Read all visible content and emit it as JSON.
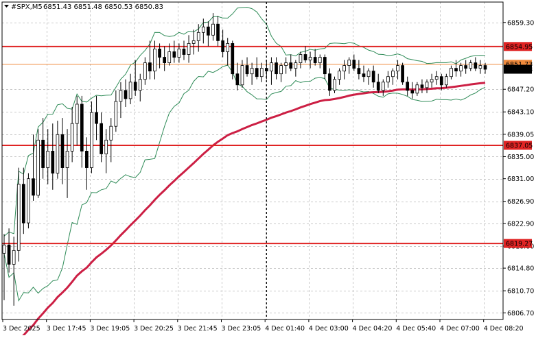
{
  "chart_data": {
    "type": "candlestick",
    "title": {
      "symbol": "#SPX,M5",
      "ohlc": "6851.43 6851.48 6850.53 6850.83"
    },
    "ylim": [
      6805.5,
      6863.0
    ],
    "y_ticks": [
      6859.3,
      6847.2,
      6843.1,
      6839.05,
      6835.0,
      6831.0,
      6826.9,
      6822.9,
      6818.8,
      6814.8,
      6810.7,
      6806.7
    ],
    "y_tick_labels": [
      "6859.30",
      "6847.20",
      "6843.10",
      "6839.05",
      "6835.00",
      "6831.00",
      "6826.90",
      "6822.90",
      "6818.80",
      "6814.80",
      "6810.70",
      "6806.70"
    ],
    "x_tick_labels": [
      "3 Dec 2025",
      "3 Dec 17:45",
      "3 Dec 19:05",
      "3 Dec 20:25",
      "3 Dec 21:45",
      "3 Dec 23:05",
      "4 Dec 01:40",
      "4 Dec 03:00",
      "4 Dec 04:20",
      "4 Dec 05:40",
      "4 Dec 07:00",
      "4 Dec 08:20"
    ],
    "horizontal_levels": [
      {
        "label": "6854.95",
        "value": 6854.95,
        "color": "#e02424",
        "style": "solid"
      },
      {
        "label": "6851.73",
        "value": 6851.73,
        "color": "#f08a3c",
        "style": "solid"
      },
      {
        "label": "6837.05",
        "value": 6837.05,
        "color": "#e02424",
        "style": "solid"
      },
      {
        "label": "6819.27",
        "value": 6819.27,
        "color": "#e02424",
        "style": "solid"
      }
    ],
    "current_price": {
      "label": "6850.83",
      "value": 6850.83
    },
    "vertical_marker_index": 54,
    "grid": true,
    "colors": {
      "candle": "#000000",
      "bands": "#2e8b57",
      "moving_average": "#cc1f44",
      "level": "#e02424",
      "level_secondary": "#f08a3c",
      "grid": "#c8c8c8"
    },
    "candles": [
      {
        "o": 6817.5,
        "h": 6821.0,
        "l": 6809.0,
        "c": 6819.0
      },
      {
        "o": 6819.0,
        "h": 6822.0,
        "l": 6814.0,
        "c": 6815.5
      },
      {
        "o": 6815.5,
        "h": 6820.5,
        "l": 6808.0,
        "c": 6818.0
      },
      {
        "o": 6818.0,
        "h": 6833.0,
        "l": 6816.0,
        "c": 6830.0
      },
      {
        "o": 6830.0,
        "h": 6833.0,
        "l": 6821.0,
        "c": 6823.0
      },
      {
        "o": 6823.0,
        "h": 6832.0,
        "l": 6822.0,
        "c": 6831.0
      },
      {
        "o": 6831.0,
        "h": 6839.0,
        "l": 6827.0,
        "c": 6828.0
      },
      {
        "o": 6828.0,
        "h": 6840.0,
        "l": 6827.5,
        "c": 6838.0
      },
      {
        "o": 6838.0,
        "h": 6842.0,
        "l": 6831.0,
        "c": 6833.0
      },
      {
        "o": 6833.0,
        "h": 6840.0,
        "l": 6830.0,
        "c": 6836.0
      },
      {
        "o": 6836.0,
        "h": 6841.0,
        "l": 6829.0,
        "c": 6832.0
      },
      {
        "o": 6832.0,
        "h": 6841.5,
        "l": 6831.0,
        "c": 6839.0
      },
      {
        "o": 6839.0,
        "h": 6842.0,
        "l": 6830.0,
        "c": 6833.0
      },
      {
        "o": 6833.0,
        "h": 6840.0,
        "l": 6827.5,
        "c": 6836.0
      },
      {
        "o": 6836.0,
        "h": 6844.0,
        "l": 6834.0,
        "c": 6841.0
      },
      {
        "o": 6841.0,
        "h": 6846.0,
        "l": 6837.0,
        "c": 6844.5
      },
      {
        "o": 6844.5,
        "h": 6846.0,
        "l": 6833.0,
        "c": 6836.0
      },
      {
        "o": 6836.0,
        "h": 6838.5,
        "l": 6829.0,
        "c": 6833.0
      },
      {
        "o": 6833.0,
        "h": 6845.0,
        "l": 6832.0,
        "c": 6843.0
      },
      {
        "o": 6843.0,
        "h": 6846.0,
        "l": 6838.0,
        "c": 6841.0
      },
      {
        "o": 6841.0,
        "h": 6843.0,
        "l": 6834.0,
        "c": 6835.5
      },
      {
        "o": 6835.5,
        "h": 6840.0,
        "l": 6832.0,
        "c": 6838.0
      },
      {
        "o": 6838.0,
        "h": 6842.0,
        "l": 6834.0,
        "c": 6840.5
      },
      {
        "o": 6840.5,
        "h": 6847.0,
        "l": 6839.5,
        "c": 6845.0
      },
      {
        "o": 6845.0,
        "h": 6848.5,
        "l": 6842.0,
        "c": 6847.0
      },
      {
        "o": 6847.0,
        "h": 6849.0,
        "l": 6844.0,
        "c": 6845.5
      },
      {
        "o": 6845.5,
        "h": 6850.0,
        "l": 6844.5,
        "c": 6848.5
      },
      {
        "o": 6848.5,
        "h": 6852.5,
        "l": 6846.0,
        "c": 6847.0
      },
      {
        "o": 6847.0,
        "h": 6850.0,
        "l": 6845.0,
        "c": 6849.0
      },
      {
        "o": 6849.0,
        "h": 6853.0,
        "l": 6848.0,
        "c": 6852.0
      },
      {
        "o": 6852.0,
        "h": 6856.0,
        "l": 6849.0,
        "c": 6850.5
      },
      {
        "o": 6850.5,
        "h": 6856.0,
        "l": 6849.0,
        "c": 6854.5
      },
      {
        "o": 6854.5,
        "h": 6855.5,
        "l": 6851.0,
        "c": 6853.0
      },
      {
        "o": 6853.0,
        "h": 6855.0,
        "l": 6850.5,
        "c": 6852.0
      },
      {
        "o": 6852.0,
        "h": 6855.5,
        "l": 6851.5,
        "c": 6854.0
      },
      {
        "o": 6854.0,
        "h": 6856.0,
        "l": 6852.0,
        "c": 6853.0
      },
      {
        "o": 6853.0,
        "h": 6855.5,
        "l": 6852.0,
        "c": 6854.5
      },
      {
        "o": 6854.5,
        "h": 6856.0,
        "l": 6852.5,
        "c": 6853.5
      },
      {
        "o": 6853.5,
        "h": 6857.0,
        "l": 6852.0,
        "c": 6855.5
      },
      {
        "o": 6855.5,
        "h": 6858.0,
        "l": 6853.5,
        "c": 6856.0
      },
      {
        "o": 6856.0,
        "h": 6859.0,
        "l": 6854.0,
        "c": 6857.5
      },
      {
        "o": 6857.5,
        "h": 6860.0,
        "l": 6855.5,
        "c": 6858.5
      },
      {
        "o": 6858.5,
        "h": 6859.5,
        "l": 6855.0,
        "c": 6857.0
      },
      {
        "o": 6857.0,
        "h": 6861.0,
        "l": 6856.0,
        "c": 6859.0
      },
      {
        "o": 6859.0,
        "h": 6860.5,
        "l": 6855.0,
        "c": 6856.0
      },
      {
        "o": 6856.0,
        "h": 6858.0,
        "l": 6853.0,
        "c": 6854.0
      },
      {
        "o": 6854.0,
        "h": 6856.5,
        "l": 6851.5,
        "c": 6855.5
      },
      {
        "o": 6855.5,
        "h": 6856.0,
        "l": 6849.0,
        "c": 6850.0
      },
      {
        "o": 6850.0,
        "h": 6852.0,
        "l": 6847.0,
        "c": 6848.0
      },
      {
        "o": 6848.0,
        "h": 6852.5,
        "l": 6847.5,
        "c": 6851.5
      },
      {
        "o": 6851.5,
        "h": 6853.0,
        "l": 6849.5,
        "c": 6850.0
      },
      {
        "o": 6850.0,
        "h": 6852.0,
        "l": 6848.0,
        "c": 6851.0
      },
      {
        "o": 6851.0,
        "h": 6853.0,
        "l": 6849.0,
        "c": 6849.5
      },
      {
        "o": 6849.5,
        "h": 6852.0,
        "l": 6848.5,
        "c": 6851.0
      },
      {
        "o": 6851.0,
        "h": 6852.5,
        "l": 6849.0,
        "c": 6850.5
      },
      {
        "o": 6850.5,
        "h": 6853.0,
        "l": 6848.0,
        "c": 6852.0
      },
      {
        "o": 6852.0,
        "h": 6853.0,
        "l": 6849.0,
        "c": 6850.0
      },
      {
        "o": 6850.0,
        "h": 6852.0,
        "l": 6848.5,
        "c": 6851.5
      },
      {
        "o": 6851.5,
        "h": 6853.0,
        "l": 6850.0,
        "c": 6852.0
      },
      {
        "o": 6852.0,
        "h": 6853.5,
        "l": 6850.5,
        "c": 6851.0
      },
      {
        "o": 6851.0,
        "h": 6852.5,
        "l": 6849.5,
        "c": 6852.0
      },
      {
        "o": 6852.0,
        "h": 6854.0,
        "l": 6851.0,
        "c": 6853.5
      },
      {
        "o": 6853.5,
        "h": 6855.0,
        "l": 6852.0,
        "c": 6852.5
      },
      {
        "o": 6852.5,
        "h": 6854.0,
        "l": 6851.0,
        "c": 6853.0
      },
      {
        "o": 6853.0,
        "h": 6854.5,
        "l": 6851.5,
        "c": 6852.0
      },
      {
        "o": 6852.0,
        "h": 6853.5,
        "l": 6851.0,
        "c": 6853.0
      },
      {
        "o": 6853.0,
        "h": 6853.5,
        "l": 6849.0,
        "c": 6850.0
      },
      {
        "o": 6850.0,
        "h": 6851.0,
        "l": 6846.0,
        "c": 6847.0
      },
      {
        "o": 6847.0,
        "h": 6849.5,
        "l": 6846.5,
        "c": 6849.0
      },
      {
        "o": 6849.0,
        "h": 6851.0,
        "l": 6848.0,
        "c": 6850.5
      },
      {
        "o": 6850.5,
        "h": 6852.5,
        "l": 6849.0,
        "c": 6851.5
      },
      {
        "o": 6851.5,
        "h": 6853.0,
        "l": 6850.0,
        "c": 6852.5
      },
      {
        "o": 6852.5,
        "h": 6853.5,
        "l": 6850.5,
        "c": 6851.0
      },
      {
        "o": 6851.0,
        "h": 6852.5,
        "l": 6849.0,
        "c": 6850.0
      },
      {
        "o": 6850.0,
        "h": 6851.5,
        "l": 6848.5,
        "c": 6849.5
      },
      {
        "o": 6849.5,
        "h": 6851.0,
        "l": 6848.0,
        "c": 6850.5
      },
      {
        "o": 6850.5,
        "h": 6851.5,
        "l": 6847.5,
        "c": 6848.5
      },
      {
        "o": 6848.5,
        "h": 6850.0,
        "l": 6846.5,
        "c": 6847.0
      },
      {
        "o": 6847.0,
        "h": 6849.0,
        "l": 6846.0,
        "c": 6848.5
      },
      {
        "o": 6848.5,
        "h": 6850.5,
        "l": 6847.5,
        "c": 6849.5
      },
      {
        "o": 6849.5,
        "h": 6851.0,
        "l": 6848.0,
        "c": 6850.5
      },
      {
        "o": 6850.5,
        "h": 6852.5,
        "l": 6849.0,
        "c": 6851.5
      },
      {
        "o": 6851.5,
        "h": 6852.0,
        "l": 6848.0,
        "c": 6848.5
      },
      {
        "o": 6848.5,
        "h": 6849.5,
        "l": 6846.0,
        "c": 6847.0
      },
      {
        "o": 6847.0,
        "h": 6848.5,
        "l": 6845.5,
        "c": 6846.5
      },
      {
        "o": 6846.5,
        "h": 6848.5,
        "l": 6846.0,
        "c": 6848.0
      },
      {
        "o": 6848.0,
        "h": 6849.0,
        "l": 6846.5,
        "c": 6847.5
      },
      {
        "o": 6847.5,
        "h": 6849.0,
        "l": 6846.5,
        "c": 6848.5
      },
      {
        "o": 6848.5,
        "h": 6850.0,
        "l": 6847.5,
        "c": 6849.0
      },
      {
        "o": 6849.0,
        "h": 6850.5,
        "l": 6848.0,
        "c": 6849.5
      },
      {
        "o": 6849.5,
        "h": 6850.0,
        "l": 6847.0,
        "c": 6848.0
      },
      {
        "o": 6848.0,
        "h": 6850.0,
        "l": 6847.5,
        "c": 6849.5
      },
      {
        "o": 6849.5,
        "h": 6851.5,
        "l": 6849.0,
        "c": 6851.0
      },
      {
        "o": 6851.0,
        "h": 6852.5,
        "l": 6849.5,
        "c": 6850.5
      },
      {
        "o": 6850.5,
        "h": 6852.0,
        "l": 6849.5,
        "c": 6851.5
      },
      {
        "o": 6851.5,
        "h": 6852.5,
        "l": 6850.0,
        "c": 6851.0
      },
      {
        "o": 6851.0,
        "h": 6852.5,
        "l": 6850.5,
        "c": 6852.0
      },
      {
        "o": 6852.0,
        "h": 6853.0,
        "l": 6850.5,
        "c": 6851.0
      },
      {
        "o": 6851.0,
        "h": 6852.5,
        "l": 6850.0,
        "c": 6851.5
      },
      {
        "o": 6851.5,
        "h": 6852.0,
        "l": 6850.0,
        "c": 6850.83
      }
    ]
  }
}
